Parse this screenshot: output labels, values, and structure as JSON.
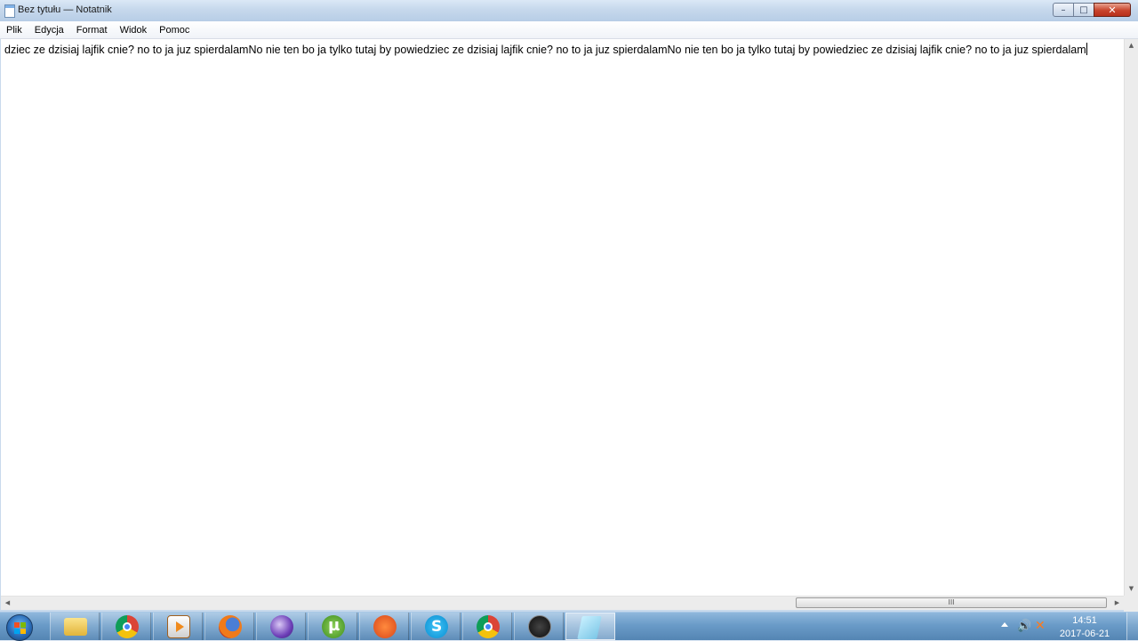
{
  "window": {
    "title": "Bez tytułu — Notatnik",
    "buttons": {
      "minimize": "–",
      "maximize": "□",
      "close": "✕"
    }
  },
  "menu": {
    "items": [
      "Plik",
      "Edycja",
      "Format",
      "Widok",
      "Pomoc"
    ]
  },
  "editor": {
    "text": "dziec ze dzisiaj lajfik cnie? no to ja juz spierdalamNo nie  ten bo ja tylko tutaj by powiedziec ze dzisiaj lajfik cnie? no to ja juz spierdalamNo nie  ten bo ja tylko tutaj by powiedziec ze dzisiaj lajfik cnie? no to ja juz spierdalam"
  },
  "scrollbars": {
    "up_arrow": "▲",
    "down_arrow": "▼",
    "left_arrow": "◀",
    "right_arrow": "▶",
    "thumb_grip": "III"
  },
  "taskbar": {
    "apps": [
      "folder-icon",
      "chrome-icon",
      "media-player-icon",
      "firefox-icon",
      "purple-app-icon",
      "utorrent-icon",
      "orange-app-icon",
      "skype-icon",
      "chrome-icon",
      "obs-icon",
      "notepad-icon"
    ],
    "tray": {
      "volume": "🔊",
      "network": "✕"
    },
    "clock": {
      "time": "14:51",
      "date": "2017-06-21"
    }
  }
}
